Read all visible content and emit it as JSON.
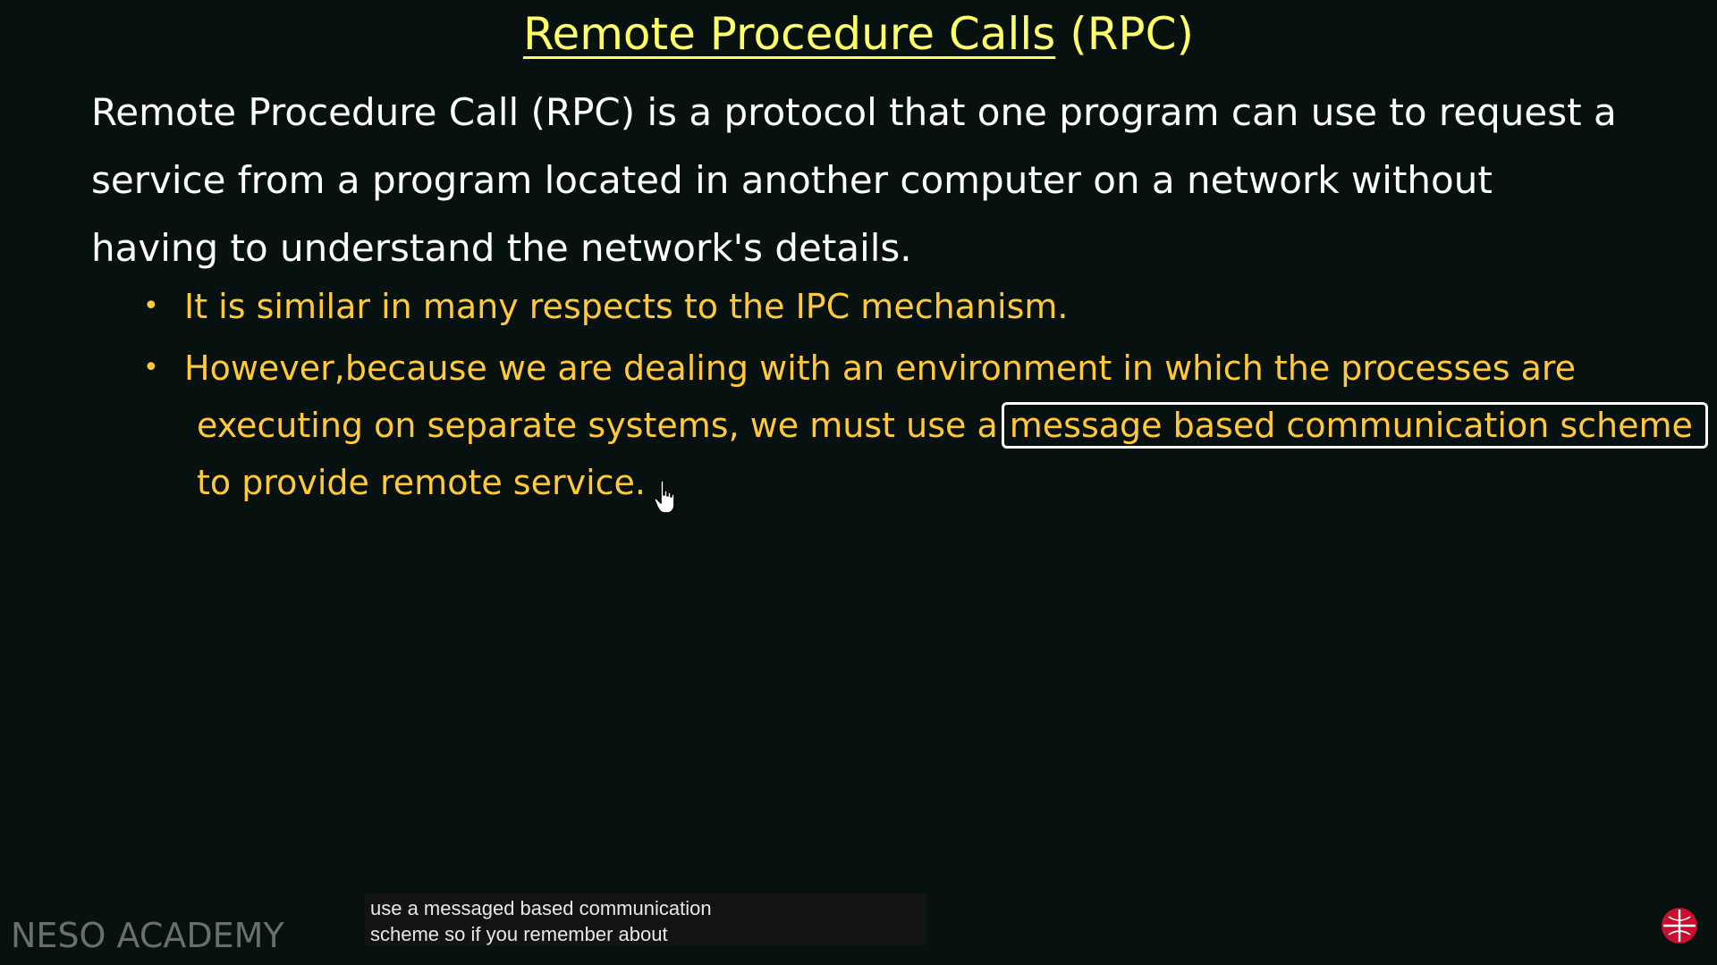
{
  "title": {
    "underlined": "Remote Procedure Calls",
    "suffix": "(RPC)"
  },
  "intro": {
    "lines": [
      "Remote Procedure Call (RPC) is a protocol that one program can use to request a",
      "service from a program located in another computer on a network without",
      "having to understand the network's details."
    ]
  },
  "bullets": [
    {
      "marker": "•",
      "lines": [
        "It is similar in many respects to the IPC mechanism."
      ]
    },
    {
      "marker": "•",
      "line1": "However,because we are dealing with an environment in which the processes are",
      "line2_prefix": "executing on separate systems, we must use a",
      "line2_boxed": "message based communication scheme",
      "line3": "to provide remote service."
    }
  ],
  "caption": {
    "lines": [
      "use a messaged based communication",
      "scheme so if you remember about"
    ]
  },
  "watermark": "NESO ACADEMY",
  "colors": {
    "background": "#071210",
    "title": "#ffff66",
    "body": "#ffffff",
    "bullet_text": "#ffc93a",
    "logo": "#c8102e"
  },
  "icons": {
    "cursor": "hand-pointer-icon",
    "logo": "neso-logo-icon"
  }
}
